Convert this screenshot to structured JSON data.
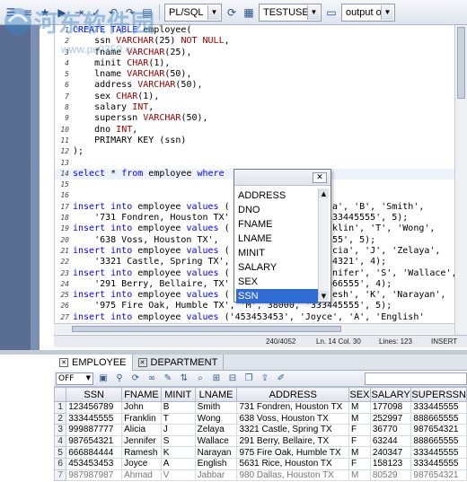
{
  "toolbar": {
    "language": "PL/SQL",
    "connection": "TESTUSER",
    "output": "output off"
  },
  "watermark": {
    "text": "河东软件园",
    "url": "www.pc0359.cn"
  },
  "editor": {
    "lines": [
      {
        "n": "1",
        "html": "<span class=\"kw\">CREATE TABLE</span> employee("
      },
      {
        "n": "2",
        "html": "    ssn <span class=\"ty\">VARCHAR</span>(25) <span class=\"nul\">NOT NULL</span>,"
      },
      {
        "n": "3",
        "html": "    fname <span class=\"ty\">VARCHAR</span>(25),"
      },
      {
        "n": "4",
        "html": "    minit <span class=\"ty\">CHAR</span>(1),"
      },
      {
        "n": "5",
        "html": "    lname <span class=\"ty\">VARCHAR</span>(50),"
      },
      {
        "n": "6",
        "html": "    address <span class=\"ty\">VARCHAR</span>(50),"
      },
      {
        "n": "7",
        "html": "    sex <span class=\"ty\">CHAR</span>(1),"
      },
      {
        "n": "8",
        "html": "    salary <span class=\"ty\">INT</span>,"
      },
      {
        "n": "9",
        "html": "    superssn <span class=\"ty\">VARCHAR</span>(50),"
      },
      {
        "n": "10",
        "html": "    dno <span class=\"ty\">INT</span>,"
      },
      {
        "n": "11",
        "html": "    PRIMARY KEY (ssn)"
      },
      {
        "n": "12",
        "html": ");"
      },
      {
        "n": "13",
        "html": ""
      },
      {
        "n": "14",
        "html": "<span class=\"kw\">select</span> * <span class=\"kw\">from</span> employee <span class=\"kw\">where</span>",
        "current": true
      },
      {
        "n": "15",
        "html": ""
      },
      {
        "n": "16",
        "html": ""
      },
      {
        "n": "17",
        "html": "<span class=\"kw\">insert into</span> employee <span class=\"kw\">values</span> (                   a', 'B', 'Smith',"
      },
      {
        "n": "18",
        "html": "    '731 Fondren, Houston TX'                  333445555', 5);"
      },
      {
        "n": "19",
        "html": "<span class=\"kw\">insert into</span> employee <span class=\"kw\">values</span> (                   klin', 'T', 'Wong',"
      },
      {
        "n": "20",
        "html": "    '638 Voss, Houston TX',                    555', 5);"
      },
      {
        "n": "21",
        "html": "<span class=\"kw\">insert into</span> employee <span class=\"kw\">values</span> (                   cia', 'J', 'Zelaya',"
      },
      {
        "n": "22",
        "html": "    '3321 Castle, Spring TX',                  54321', 4);"
      },
      {
        "n": "23",
        "html": "<span class=\"kw\">insert into</span> employee <span class=\"kw\">values</span> (                   nifer', 'S', 'Wallace',"
      },
      {
        "n": "24",
        "html": "    '291 Berry, Bellaire, TX'                  666555', 4);"
      },
      {
        "n": "25",
        "html": "<span class=\"kw\">insert into</span> employee <span class=\"kw\">values</span> (                   esh', 'K', 'Narayan',"
      },
      {
        "n": "26",
        "html": "    '975 Fire Oak, Humble TX', 'M', 38000, '333445555', 5);"
      },
      {
        "n": "27",
        "html": "<span class=\"kw\">insert into</span> employee <span class=\"kw\">values</span> ('453453453', 'Joyce', 'A', 'English'"
      }
    ]
  },
  "status": {
    "position": "240/4052",
    "cursor": "Ln. 14 Col. 30",
    "lines": "Lines: 123",
    "mode": "INSERT"
  },
  "autocomplete": {
    "items": [
      "ADDRESS",
      "DNO",
      "FNAME",
      "LNAME",
      "MINIT",
      "SALARY",
      "SEX",
      "SSN"
    ],
    "selected": "SSN"
  },
  "tabs": [
    {
      "label": "EMPLOYEE",
      "active": true
    },
    {
      "label": "DEPARTMENT",
      "active": false
    }
  ],
  "grid_toolbar": {
    "mode": "OFF"
  },
  "grid": {
    "columns": [
      "SSN",
      "FNAME",
      "MINIT",
      "LNAME",
      "ADDRESS",
      "SEX",
      "SALARY",
      "SUPERSSN"
    ],
    "rows": [
      [
        "1",
        "123456789",
        "John",
        "B",
        "Smith",
        "731 Fondren, Houston TX",
        "M",
        "177098",
        "333445555"
      ],
      [
        "2",
        "333445555",
        "Franklin",
        "T",
        "Wong",
        "638 Voss, Houston TX",
        "M",
        "252997",
        "888665555"
      ],
      [
        "3",
        "999887777",
        "Alicia",
        "J",
        "Zelaya",
        "3321 Castle, Spring TX",
        "F",
        "36770",
        "987654321"
      ],
      [
        "4",
        "987654321",
        "Jennifer",
        "S",
        "Wallace",
        "291 Berry, Bellaire, TX",
        "F",
        "63244",
        "888665555"
      ],
      [
        "5",
        "666884444",
        "Ramesh",
        "K",
        "Narayan",
        "975 Fire Oak, Humble TX",
        "M",
        "240347",
        "333445555"
      ],
      [
        "6",
        "453453453",
        "Joyce",
        "A",
        "English",
        "5631 Rice, Houston TX",
        "F",
        "158123",
        "333445555"
      ],
      [
        "7",
        "987987987",
        "Ahmad",
        "V",
        "Jabbar",
        "980 Dallas, Houston TX",
        "M",
        "80529",
        "987654321"
      ]
    ]
  }
}
